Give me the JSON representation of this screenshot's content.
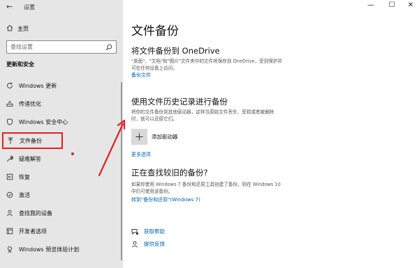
{
  "window": {
    "title": "设置",
    "back_glyph": "←",
    "minimize_glyph": "—",
    "maximize_glyph": "☐",
    "close_glyph": "✕"
  },
  "sidebar": {
    "home_label": "主页",
    "search_placeholder": "查找设置",
    "section_title": "更新和安全",
    "items": [
      {
        "label": "Windows 更新",
        "icon": "refresh-icon"
      },
      {
        "label": "传递优化",
        "icon": "delivery-optimization-icon"
      },
      {
        "label": "Windows 安全中心",
        "icon": "shield-icon"
      },
      {
        "label": "文件备份",
        "icon": "backup-arrow-icon",
        "active": true
      },
      {
        "label": "疑难解答",
        "icon": "wrench-icon"
      },
      {
        "label": "恢复",
        "icon": "recovery-icon"
      },
      {
        "label": "激活",
        "icon": "activation-check-icon"
      },
      {
        "label": "查找我的设备",
        "icon": "person-locate-icon"
      },
      {
        "label": "开发者选项",
        "icon": "developer-icon"
      },
      {
        "label": "Windows 预览体验计划",
        "icon": "insider-icon"
      }
    ]
  },
  "main": {
    "title": "文件备份",
    "onedrive": {
      "heading": "将文件备份到 OneDrive",
      "desc_line1": "\"桌面\"、\"文档\"和\"图片\"文件夹中的文件将保存到 OneDrive，受到保护并",
      "desc_line2": "可在任何设备上访问。",
      "link": "备份文件"
    },
    "history": {
      "heading": "使用文件历史记录进行备份",
      "desc_line1": "将你的文件备份到其他驱动器，这样当原始文件丢失、受损或者被删除",
      "desc_line2": "时，就可以还原它们。",
      "add_label": "添加驱动器",
      "more_link": "更多选项"
    },
    "older": {
      "heading": "正在查找较旧的备份?",
      "desc_line1": "如果你使用 Windows 7 备份和还原工具创建了备份，则在 Windows 10",
      "desc_line2": "中仍可使用该备份。",
      "link": "转到\"备份和还原\"(Windows 7)"
    },
    "help": {
      "get_help": "获取帮助",
      "feedback": "提供反馈"
    }
  },
  "colors": {
    "accent_link": "#0063b1",
    "highlight_red": "#e02020",
    "sidebar_bg": "#e6e6e6"
  }
}
